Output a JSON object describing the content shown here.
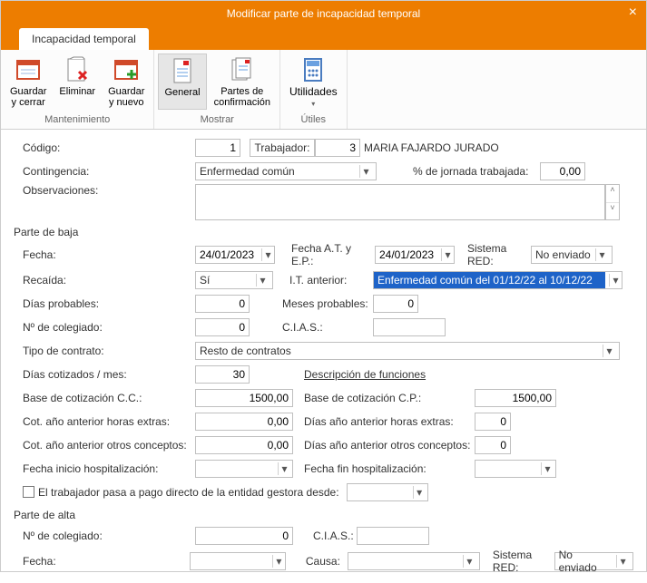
{
  "window": {
    "title": "Modificar parte de incapacidad temporal"
  },
  "tab": {
    "label": "Incapacidad temporal"
  },
  "ribbon": {
    "maintenance": {
      "title": "Mantenimiento",
      "save_close": "Guardar\ny cerrar",
      "delete": "Eliminar",
      "save_new": "Guardar\ny nuevo"
    },
    "show": {
      "title": "Mostrar",
      "general": "General",
      "confirm": "Partes de\nconfirmación"
    },
    "utils": {
      "title": "Útiles",
      "utilities": "Utilidades"
    }
  },
  "form": {
    "codigo_label": "Código:",
    "codigo": "1",
    "trabajador_label": "Trabajador:",
    "trabajador_num": "3",
    "trabajador_name": "MARIA FAJARDO JURADO",
    "contingencia_label": "Contingencia:",
    "contingencia": "Enfermedad común",
    "jornada_label": "% de jornada trabajada:",
    "jornada": "0,00",
    "observ_label": "Observaciones:",
    "observ": ""
  },
  "baja": {
    "title": "Parte de baja",
    "fecha_label": "Fecha:",
    "fecha": "24/01/2023",
    "fecha_at_label": "Fecha A.T. y E.P.:",
    "fecha_at": "24/01/2023",
    "sistema_label": "Sistema RED:",
    "sistema": "No enviado",
    "recaida_label": "Recaída:",
    "recaida": "Sí",
    "it_label": "I.T. anterior:",
    "it": "Enfermedad común del 01/12/22 al 10/12/22",
    "dias_prob_label": "Días probables:",
    "dias_prob": "0",
    "meses_prob_label": "Meses probables:",
    "meses_prob": "0",
    "coleg_label": "Nº de colegiado:",
    "coleg": "0",
    "cias_label": "C.I.A.S.:",
    "cias": "",
    "tipo_label": "Tipo de contrato:",
    "tipo": "Resto de contratos",
    "dias_cot_label": "Días cotizados / mes:",
    "dias_cot": "30",
    "desc_func_label": "Descripción de funciones",
    "base_cc_label": "Base de cotización C.C.:",
    "base_cc": "1500,00",
    "base_cp_label": "Base de cotización C.P.:",
    "base_cp": "1500,00",
    "cot_extras_label": "Cot. año anterior horas extras:",
    "cot_extras": "0,00",
    "dias_extras_label": "Días año anterior horas extras:",
    "dias_extras": "0",
    "cot_otros_label": "Cot. año anterior otros conceptos:",
    "cot_otros": "0,00",
    "dias_otros_label": "Días año anterior otros conceptos:",
    "dias_otros": "0",
    "hosp_ini_label": "Fecha inicio hospitalización:",
    "hosp_fin_label": "Fecha fin hospitalización:",
    "pago_label": "El trabajador pasa a pago directo de la entidad gestora desde:"
  },
  "alta": {
    "title": "Parte de alta",
    "coleg_label": "Nº de colegiado:",
    "coleg": "0",
    "cias_label": "C.I.A.S.:",
    "cias": "",
    "fecha_label": "Fecha:",
    "fecha": "",
    "causa_label": "Causa:",
    "causa": "",
    "sistema_label": "Sistema RED:",
    "sistema": "No enviado"
  }
}
